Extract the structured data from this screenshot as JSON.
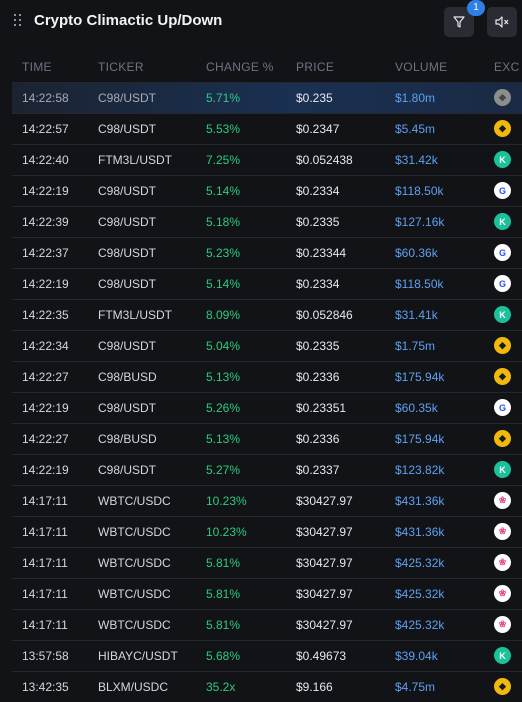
{
  "header": {
    "title": "Crypto Climactic Up/Down",
    "filter_badge": "1"
  },
  "columns": {
    "time": "TIME",
    "ticker": "TICKER",
    "change": "CHANGE %",
    "price": "PRICE",
    "volume": "VOLUME",
    "exchange": "EXC"
  },
  "rows": [
    {
      "time": "14:22:58",
      "ticker": "C98/USDT",
      "change": "5.71%",
      "price": "$0.235",
      "volume": "$1.80m",
      "exchange_icon": "binance-icon"
    },
    {
      "time": "14:22:57",
      "ticker": "C98/USDT",
      "change": "5.53%",
      "price": "$0.2347",
      "volume": "$5.45m",
      "exchange_icon": "binance-icon"
    },
    {
      "time": "14:22:40",
      "ticker": "FTM3L/USDT",
      "change": "7.25%",
      "price": "$0.052438",
      "volume": "$31.42k",
      "exchange_icon": "kucoin-icon"
    },
    {
      "time": "14:22:19",
      "ticker": "C98/USDT",
      "change": "5.14%",
      "price": "$0.2334",
      "volume": "$118.50k",
      "exchange_icon": "gateio-icon"
    },
    {
      "time": "14:22:39",
      "ticker": "C98/USDT",
      "change": "5.18%",
      "price": "$0.2335",
      "volume": "$127.16k",
      "exchange_icon": "kucoin-icon"
    },
    {
      "time": "14:22:37",
      "ticker": "C98/USDT",
      "change": "5.23%",
      "price": "$0.23344",
      "volume": "$60.36k",
      "exchange_icon": "gateio-icon"
    },
    {
      "time": "14:22:19",
      "ticker": "C98/USDT",
      "change": "5.14%",
      "price": "$0.2334",
      "volume": "$118.50k",
      "exchange_icon": "gateio-icon"
    },
    {
      "time": "14:22:35",
      "ticker": "FTM3L/USDT",
      "change": "8.09%",
      "price": "$0.052846",
      "volume": "$31.41k",
      "exchange_icon": "kucoin-icon"
    },
    {
      "time": "14:22:34",
      "ticker": "C98/USDT",
      "change": "5.04%",
      "price": "$0.2335",
      "volume": "$1.75m",
      "exchange_icon": "binance-icon"
    },
    {
      "time": "14:22:27",
      "ticker": "C98/BUSD",
      "change": "5.13%",
      "price": "$0.2336",
      "volume": "$175.94k",
      "exchange_icon": "binance-icon"
    },
    {
      "time": "14:22:19",
      "ticker": "C98/USDT",
      "change": "5.26%",
      "price": "$0.23351",
      "volume": "$60.35k",
      "exchange_icon": "gateio-icon"
    },
    {
      "time": "14:22:27",
      "ticker": "C98/BUSD",
      "change": "5.13%",
      "price": "$0.2336",
      "volume": "$175.94k",
      "exchange_icon": "binance-icon"
    },
    {
      "time": "14:22:19",
      "ticker": "C98/USDT",
      "change": "5.27%",
      "price": "$0.2337",
      "volume": "$123.82k",
      "exchange_icon": "kucoin-icon"
    },
    {
      "time": "14:17:11",
      "ticker": "WBTC/USDC",
      "change": "10.23%",
      "price": "$30427.97",
      "volume": "$431.36k",
      "exchange_icon": "apeswap-icon"
    },
    {
      "time": "14:17:11",
      "ticker": "WBTC/USDC",
      "change": "10.23%",
      "price": "$30427.97",
      "volume": "$431.36k",
      "exchange_icon": "apeswap-icon"
    },
    {
      "time": "14:17:11",
      "ticker": "WBTC/USDC",
      "change": "5.81%",
      "price": "$30427.97",
      "volume": "$425.32k",
      "exchange_icon": "apeswap-icon"
    },
    {
      "time": "14:17:11",
      "ticker": "WBTC/USDC",
      "change": "5.81%",
      "price": "$30427.97",
      "volume": "$425.32k",
      "exchange_icon": "apeswap-icon"
    },
    {
      "time": "14:17:11",
      "ticker": "WBTC/USDC",
      "change": "5.81%",
      "price": "$30427.97",
      "volume": "$425.32k",
      "exchange_icon": "apeswap-icon"
    },
    {
      "time": "13:57:58",
      "ticker": "HIBAYC/USDT",
      "change": "5.68%",
      "price": "$0.49673",
      "volume": "$39.04k",
      "exchange_icon": "kucoin-icon"
    },
    {
      "time": "13:42:35",
      "ticker": "BLXM/USDC",
      "change": "35.2x",
      "price": "$9.166",
      "volume": "$4.75m",
      "exchange_icon": "binance-icon"
    }
  ],
  "colors": {
    "background": "#121317",
    "positive": "#2ecb80",
    "volume": "#5ea0f2",
    "highlight": "#1a3052"
  }
}
